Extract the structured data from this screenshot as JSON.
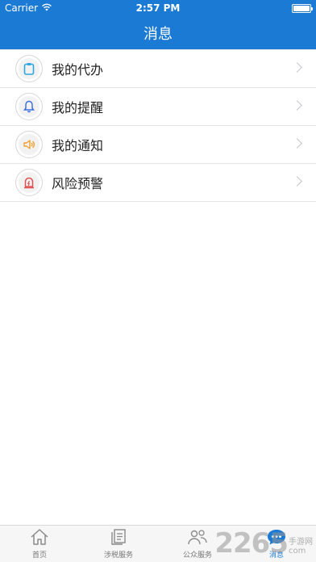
{
  "status_bar": {
    "carrier": "Carrier",
    "time": "2:57 PM",
    "battery_level": 1.0
  },
  "nav": {
    "title": "消息"
  },
  "list": {
    "items": [
      {
        "label": "我的代办",
        "icon": "clipboard-icon",
        "icon_color": "#2ea7e0"
      },
      {
        "label": "我的提醒",
        "icon": "bell-icon",
        "icon_color": "#3b6fe0"
      },
      {
        "label": "我的通知",
        "icon": "speaker-icon",
        "icon_color": "#f0a030"
      },
      {
        "label": "风险预警",
        "icon": "alarm-icon",
        "icon_color": "#e05050"
      }
    ]
  },
  "tab_bar": {
    "tabs": [
      {
        "label": "首页",
        "icon": "home-icon",
        "active": false
      },
      {
        "label": "涉税服务",
        "icon": "tax-service-icon",
        "active": false
      },
      {
        "label": "公众服务",
        "icon": "public-service-icon",
        "active": false
      },
      {
        "label": "消息",
        "icon": "message-icon",
        "active": true
      }
    ]
  },
  "watermark": {
    "number": "2265",
    "site_top": "手游网",
    "site_bottom": "com"
  },
  "colors": {
    "primary": "#1a7ad4",
    "divider": "#e4e4e4"
  }
}
